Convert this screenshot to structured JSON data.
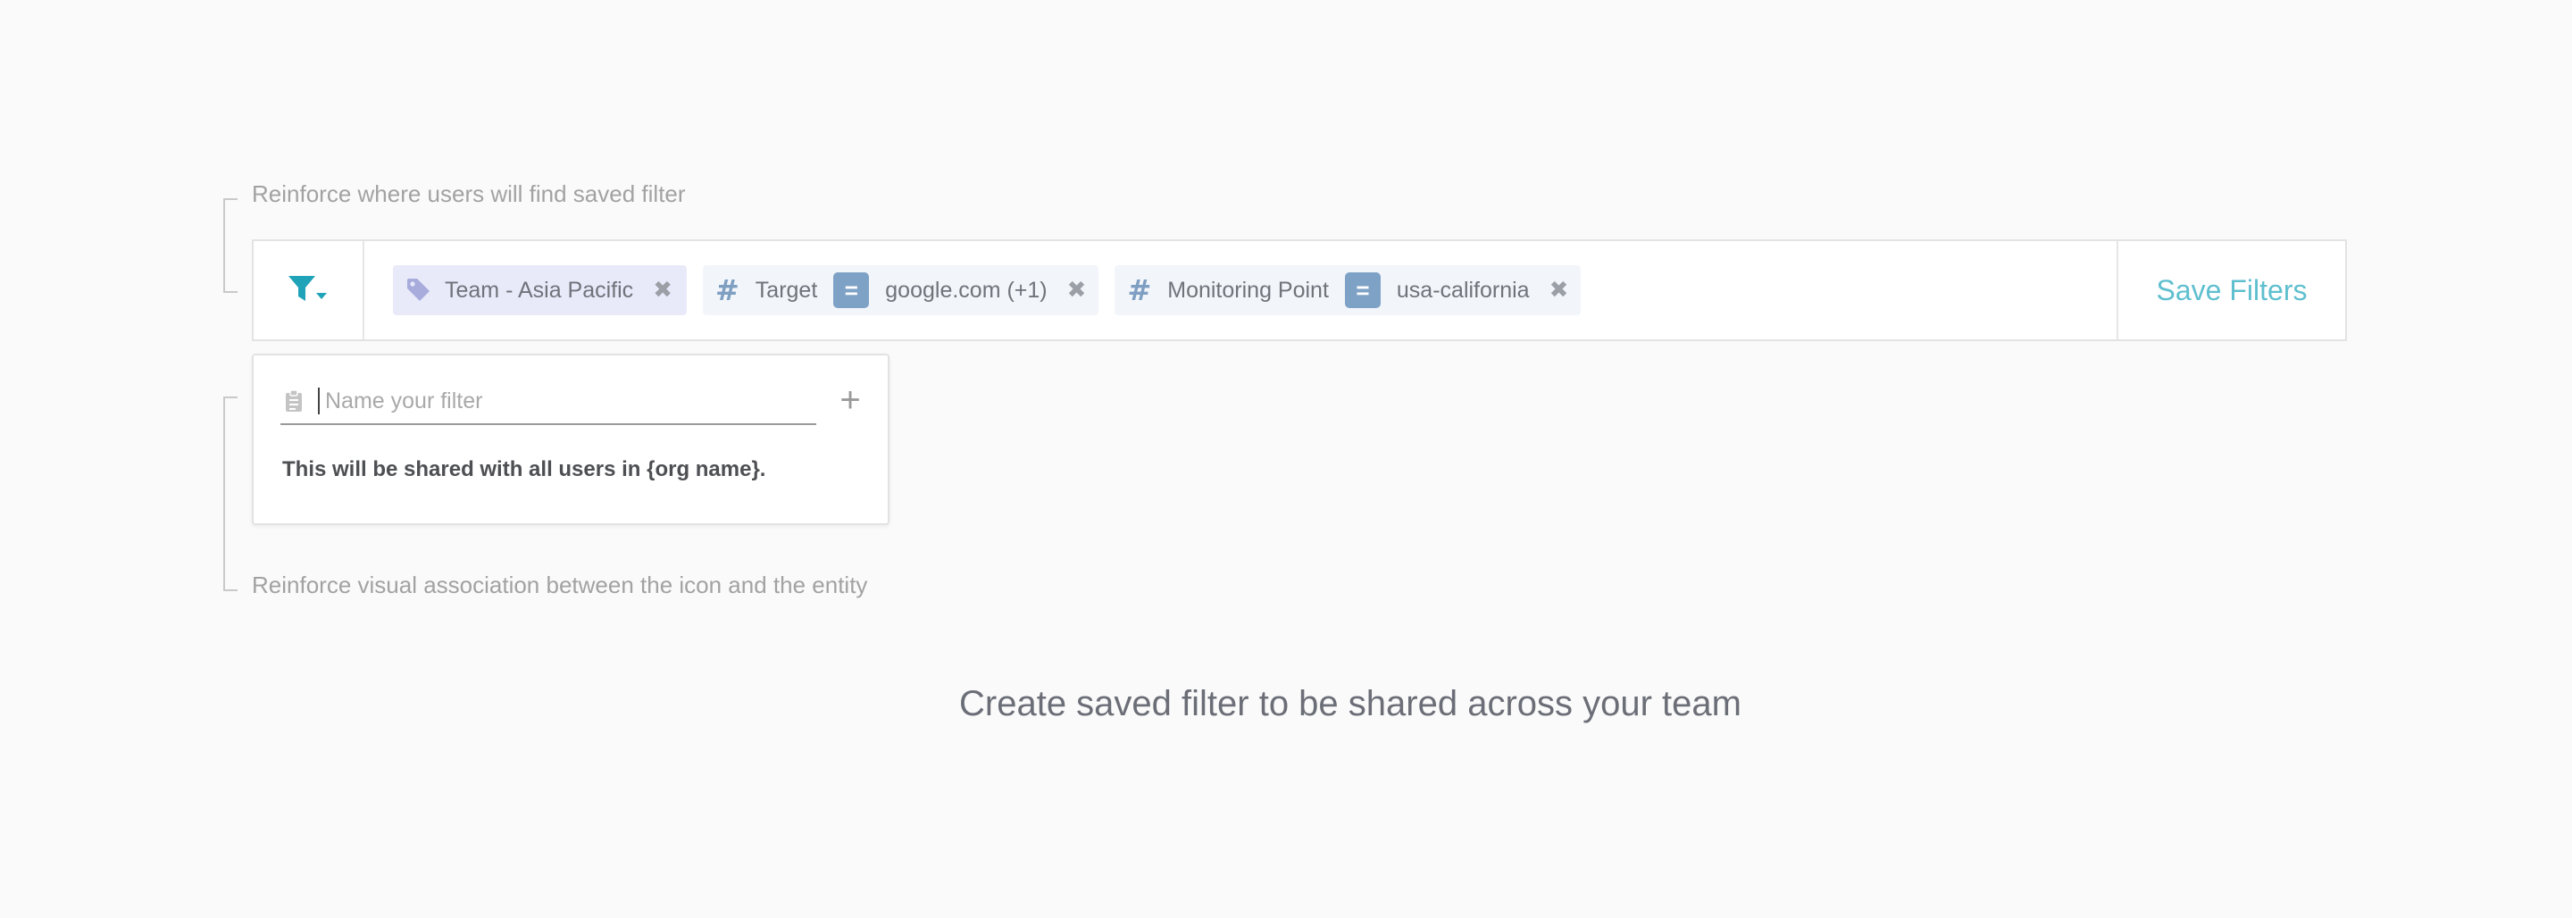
{
  "annotations": {
    "top_note": "Reinforce where users will find saved filter",
    "bottom_note": "Reinforce visual association between the icon and the entity"
  },
  "filter_bar": {
    "toggle_icon": "filter-funnel-dropdown-icon",
    "chips": [
      {
        "type": "tag",
        "icon": "tag-icon",
        "label": "Team - Asia Pacific",
        "remove": "✖"
      },
      {
        "type": "key-value",
        "icon": "#",
        "key": "Target",
        "operator": "=",
        "value": "google.com (+1)",
        "remove": "✖"
      },
      {
        "type": "key-value",
        "icon": "#",
        "key": "Monitoring Point",
        "operator": "=",
        "value": "usa-california",
        "remove": "✖"
      }
    ],
    "save_label": "Save Filters"
  },
  "popover": {
    "icon": "clipboard-icon",
    "placeholder": "Name your filter",
    "value": "",
    "add_label": "+",
    "share_note": "This will be shared with all users in {org name}."
  },
  "caption": "Create saved filter to be shared across your team",
  "colors": {
    "accent_teal": "#1fa3b8",
    "save_text": "#5fbfcf",
    "tag_chip_bg": "#e8eaf9",
    "kv_chip_bg": "#f2f5fa",
    "operator_bg": "#7ea2c6",
    "page_bg": "#fafafa"
  }
}
